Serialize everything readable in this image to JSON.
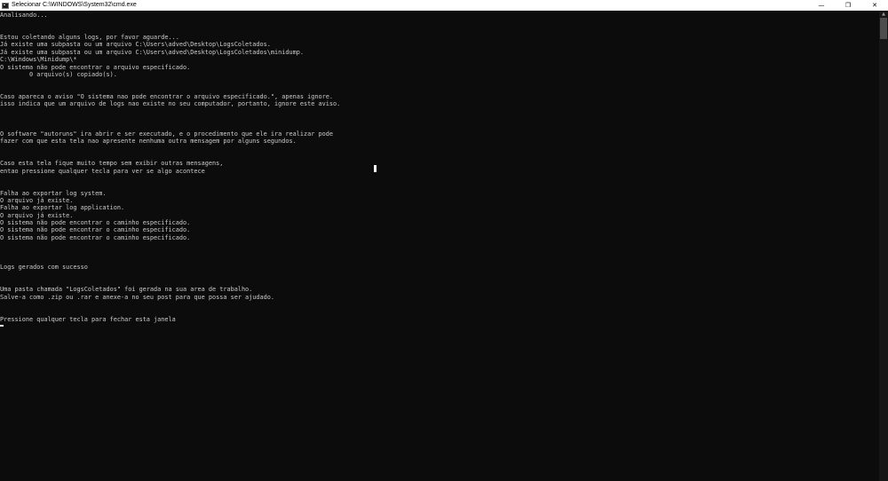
{
  "window": {
    "title": "Selecionar C:\\WINDOWS\\System32\\cmd.exe",
    "minimize_glyph": "—",
    "maximize_glyph": "❐",
    "close_glyph": "✕",
    "icon": "cmd-icon"
  },
  "console": {
    "lines": [
      "Analisando...",
      "",
      "",
      "Estou coletando alguns logs, por favor aguarde...",
      "Já existe uma subpasta ou um arquivo C:\\Users\\adved\\Desktop\\LogsColetados.",
      "Já existe uma subpasta ou um arquivo C:\\Users\\adved\\Desktop\\LogsColetados\\minidump.",
      "C:\\Windows\\Minidump\\*",
      "O sistema não pode encontrar o arquivo especificado.",
      "        0 arquivo(s) copiado(s).",
      "",
      "",
      "Caso apareca o aviso \"O sistema nao pode encontrar o arquivo especificado.\", apenas ignore.",
      "isso indica que um arquivo de logs nao existe no seu computador, portanto, ignore este aviso.",
      "",
      "",
      "",
      "O software \"autoruns\" ira abrir e ser executado, e o procedimento que ele ira realizar pode",
      "fazer com que esta tela nao apresente nenhuma outra mensagem por alguns segundos.",
      "",
      "",
      "Caso esta tela fique muito tempo sem exibir outras mensagens,",
      "entao pressione qualquer tecla para ver se algo acontece",
      "",
      "",
      "Falha ao exportar log system.",
      "O arquivo já existe.",
      "Falha ao exportar log application.",
      "O arquivo já existe.",
      "O sistema não pode encontrar o caminho especificado.",
      "O sistema não pode encontrar o caminho especificado.",
      "O sistema não pode encontrar o caminho especificado.",
      "",
      "",
      "",
      "Logs gerados com sucesso",
      "",
      "",
      "Uma pasta chamada \"LogsColetados\" foi gerada na sua area de trabalho.",
      "Salve-a como .zip ou .rar e anexe-a no seu post para que possa ser ajudado.",
      "",
      "",
      "Pressione qualquer tecla para fechar esta janela"
    ]
  }
}
